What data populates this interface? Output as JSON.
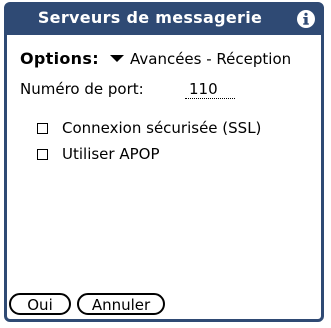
{
  "dialog": {
    "title": "Serveurs de messagerie",
    "info_icon": "info-icon",
    "options": {
      "label": "Options:",
      "selected": "Avancées - Réception"
    },
    "port": {
      "label": "Numéro de port:",
      "value": "110"
    },
    "checkboxes": [
      {
        "label": "Connexion sécurisée (SSL)",
        "checked": false
      },
      {
        "label": "Utiliser APOP",
        "checked": false
      }
    ],
    "buttons": {
      "ok": "Oui",
      "cancel": "Annuler"
    }
  },
  "colors": {
    "titlebar": "#2f4a74",
    "background": "#ffffff"
  }
}
